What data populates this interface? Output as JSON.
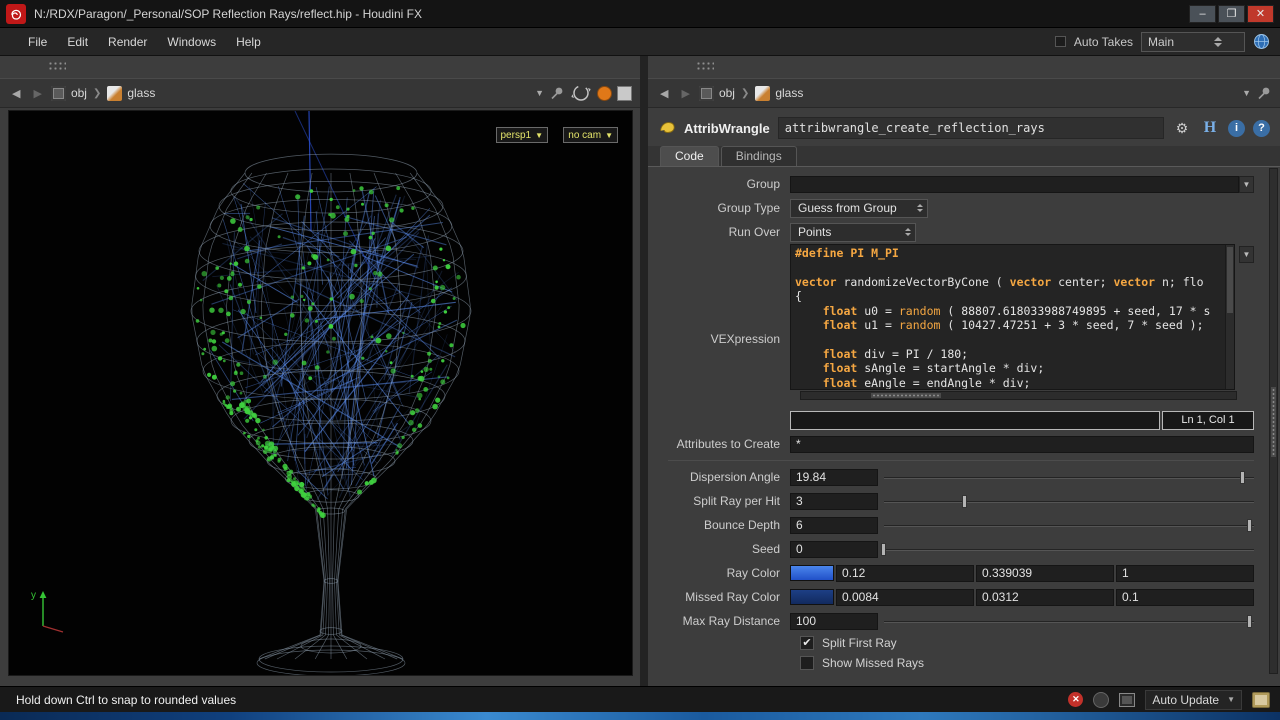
{
  "window": {
    "title": "N:/RDX/Paragon/_Personal/SOP Reflection Rays/reflect.hip - Houdini FX",
    "controls": {
      "minimize": "–",
      "maximize": "❐",
      "close": "✕"
    }
  },
  "menubar": {
    "items": [
      "File",
      "Edit",
      "Render",
      "Windows",
      "Help"
    ],
    "auto_takes_label": "Auto Takes",
    "take_menu_value": "Main"
  },
  "left_pane": {
    "path_root": "obj",
    "path_node": "glass",
    "viewport": {
      "camera_menu": "persp1",
      "camera_link": "no cam",
      "axis_y_label": "y"
    }
  },
  "right_pane": {
    "path_root": "obj",
    "path_node": "glass",
    "node_type": "AttribWrangle",
    "node_name": "attribwrangle_create_reflection_rays",
    "tabs": {
      "code": "Code",
      "bindings": "Bindings"
    },
    "params": {
      "group": {
        "label": "Group",
        "value": ""
      },
      "group_type": {
        "label": "Group Type",
        "value": "Guess from Group"
      },
      "run_over": {
        "label": "Run Over",
        "value": "Points"
      },
      "vexpression": {
        "label": "VEXpression",
        "code_lines": [
          "#define PI M_PI",
          "",
          "vector randomizeVectorByCone ( vector center; vector n; flo",
          "{",
          "    float u0 = random ( 88807.618033988749895 + seed, 17 * s",
          "    float u1 = random ( 10427.47251 + 3 * seed, 7 * seed );",
          "",
          "    float div = PI / 180;",
          "    float sAngle = startAngle * div;",
          "    float eAngle = endAngle * div;"
        ],
        "cursor_status": "Ln 1, Col 1"
      },
      "attributes_to_create": {
        "label": "Attributes to Create",
        "value": "*"
      },
      "dispersion_angle": {
        "label": "Dispersion Angle",
        "value": "19.84",
        "pos": 0.97
      },
      "split_ray_per_hit": {
        "label": "Split Ray per Hit",
        "value": "3",
        "pos": 0.22
      },
      "bounce_depth": {
        "label": "Bounce Depth",
        "value": "6",
        "pos": 0.99
      },
      "seed": {
        "label": "Seed",
        "value": "0",
        "pos": 0
      },
      "ray_color": {
        "label": "Ray Color",
        "swatch": "linear-gradient(#4a86ec,#2050c8)",
        "r": "0.12",
        "g": "0.339039",
        "b": "1"
      },
      "missed_ray_color": {
        "label": "Missed Ray Color",
        "swatch": "linear-gradient(#1d3f85,#122a5e)",
        "r": "0.0084",
        "g": "0.0312",
        "b": "0.1"
      },
      "max_ray_distance": {
        "label": "Max Ray Distance",
        "value": "100",
        "pos": 0.99
      },
      "split_first_ray": {
        "label": "Split First Ray",
        "checked": true
      },
      "show_missed_rays": {
        "label": "Show Missed Rays",
        "checked": false
      }
    }
  },
  "status_bar": {
    "message": "Hold down Ctrl to snap to rounded values",
    "update_mode": "Auto Update"
  }
}
